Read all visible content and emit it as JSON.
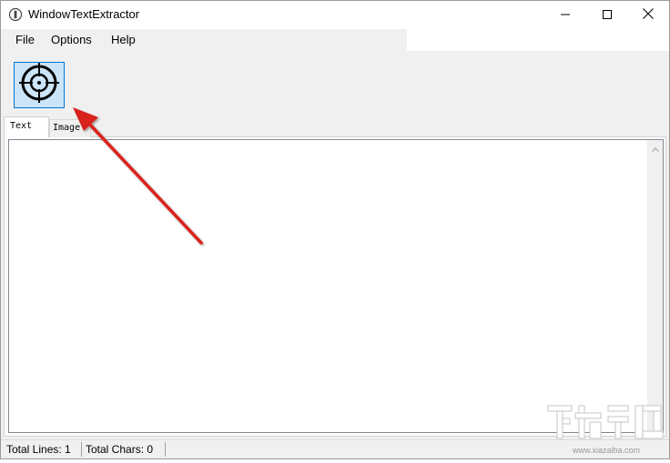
{
  "window": {
    "title": "WindowTextExtractor"
  },
  "menu": {
    "file": "File",
    "options": "Options",
    "help": "Help"
  },
  "tabs": [
    {
      "label": "Text",
      "selected": true
    },
    {
      "label": "Image",
      "selected": false
    }
  ],
  "status": {
    "total_lines": "Total Lines: 1",
    "total_chars": "Total Chars: 0"
  },
  "watermark": {
    "url": "www.xiazaiba.com"
  },
  "colors": {
    "accent": "#0078d7",
    "annotation_arrow": "#d9231f"
  },
  "icons": {
    "app": "app-icon",
    "target": "crosshair-icon",
    "minimize": "minimize-icon",
    "maximize": "maximize-icon",
    "close": "close-icon"
  }
}
